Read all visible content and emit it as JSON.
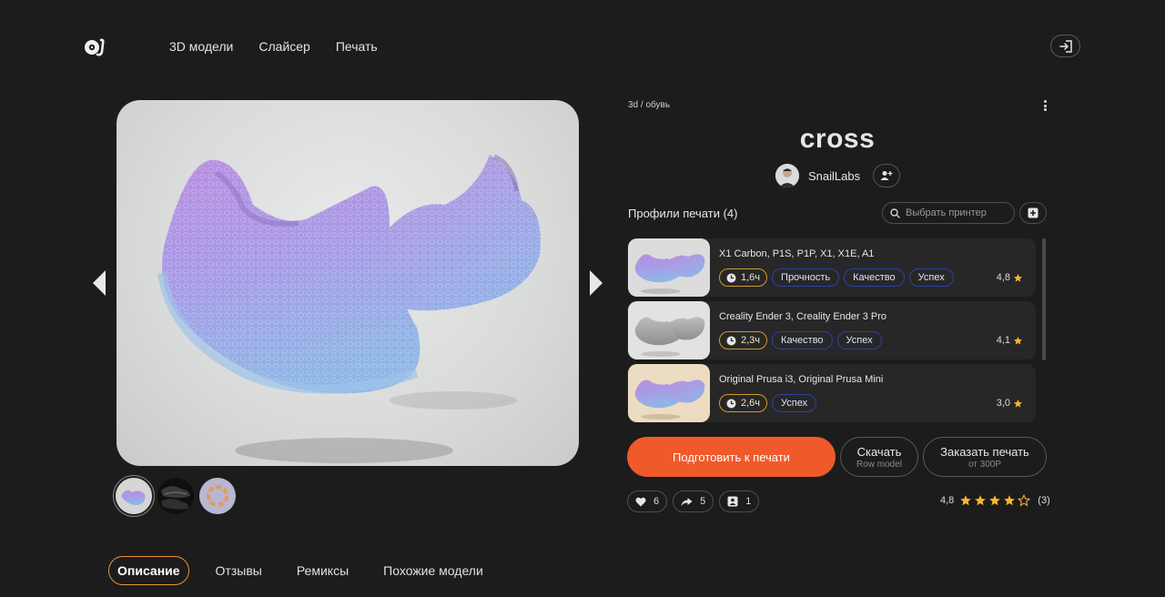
{
  "header": {
    "nav": [
      "3D модели",
      "Слайсер",
      "Печать"
    ]
  },
  "icons": {
    "logo": "snail-logo-icon",
    "login": "login-icon",
    "more": "kebab-menu-icon",
    "follow": "add-user-icon",
    "search": "search-icon",
    "add": "plus-square-icon",
    "time": "clock-icon",
    "star": "star-icon",
    "like": "heart-icon",
    "share": "share-icon",
    "makes": "image-icon",
    "prev": "arrow-left-icon",
    "next": "arrow-right-icon"
  },
  "model": {
    "breadcrumb": "3d / обувь",
    "title": "cross",
    "author": "SnailLabs",
    "thumbnails": [
      "thumb-1",
      "thumb-2",
      "thumb-3"
    ]
  },
  "profiles": {
    "title": "Профили печати (4)",
    "search_placeholder": "Выбрать принтер",
    "items": [
      {
        "printers": "X1 Carbon, P1S, P1P, X1, X1E, A1",
        "time": "1,6ч",
        "tags": [
          "Прочность",
          "Качество",
          "Успех"
        ],
        "rating": "4,8"
      },
      {
        "printers": "Creality Ender 3, Creality Ender 3 Pro",
        "time": "2,3ч",
        "tags": [
          "Качество",
          "Успех"
        ],
        "rating": "4,1"
      },
      {
        "printers": "Original Prusa i3, Original Prusa Mini",
        "time": "2,6ч",
        "tags": [
          "Успех"
        ],
        "rating": "3,0"
      }
    ]
  },
  "actions": {
    "prepare": "Подготовить к печати",
    "download": "Скачать",
    "download_sub": "Row model",
    "order": "Заказать печать",
    "order_sub": "от 300Р"
  },
  "stats": {
    "likes": "6",
    "shares": "5",
    "makes": "1",
    "rating": "4,8",
    "rating_value": 4.8,
    "stars_filled": 4,
    "stars_total": 5,
    "rating_count": "(3)"
  },
  "tabs": [
    "Описание",
    "Отзывы",
    "Ремиксы",
    "Похожие модели"
  ],
  "colors": {
    "background": "#1c1c1c",
    "accent": "#f05a2b",
    "chip_border": "#2e3fa8",
    "time_border": "#d29a2a",
    "star": "#f5b52e",
    "tab_active_border": "#e8913a"
  }
}
